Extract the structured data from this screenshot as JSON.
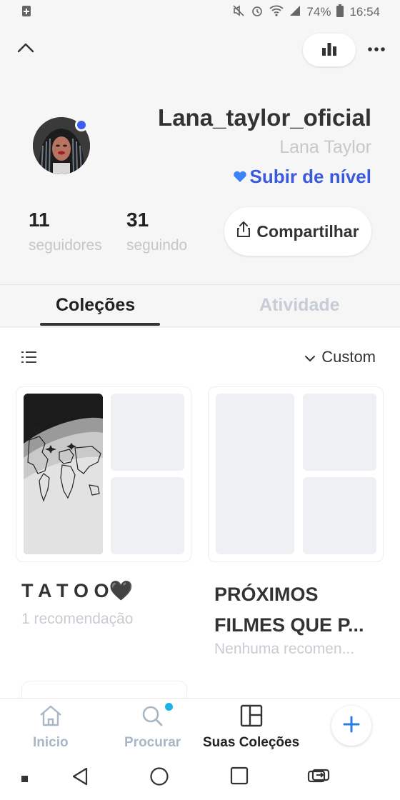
{
  "status_bar": {
    "battery": "74%",
    "time": "16:54",
    "icons": [
      "notification-icon",
      "mute-icon",
      "alarm-icon",
      "wifi-icon",
      "signal-icon",
      "battery-icon"
    ]
  },
  "top_bar": {
    "back_icon": "chevron-up-icon",
    "stats_icon": "bar-chart-icon",
    "more_icon": "more-dots-icon"
  },
  "profile": {
    "username": "Lana_taylor_oficial",
    "full_name": "Lana Taylor",
    "level_up": "Subir de nível",
    "level_icon": "heart-icon",
    "followers_count": "11",
    "followers_label": "seguidores",
    "following_count": "31",
    "following_label": "seguindo",
    "share_label": "Compartilhar"
  },
  "tabs": [
    {
      "label": "Coleções",
      "active": true
    },
    {
      "label": "Atividade",
      "active": false
    }
  ],
  "toolbar": {
    "sort_label": "Custom"
  },
  "collections": [
    {
      "title": "T A T O O🖤",
      "subtitle": "1 recomendação"
    },
    {
      "title_line1": "PRÓXIMOS",
      "title_line2": "FILMES QUE P...",
      "subtitle": "Nenhuma recomen..."
    }
  ],
  "bottom_nav": [
    {
      "label": "Inicio",
      "icon": "home-icon"
    },
    {
      "label": "Procurar",
      "icon": "search-icon"
    },
    {
      "label": "Suas Coleções",
      "icon": "collections-icon"
    }
  ],
  "colors": {
    "accent": "#3b5bdb",
    "nav_inactive": "#a9b6c8",
    "muted": "#c8c8c8",
    "dot": "#1ab3e6"
  }
}
